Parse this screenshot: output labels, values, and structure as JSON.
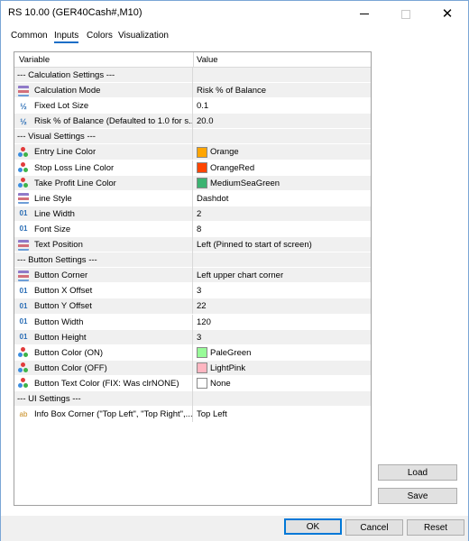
{
  "window": {
    "title": "RS 10.00 (GER40Cash#,M10)",
    "controls": {
      "minimize": "minimize-icon",
      "maximize": "maximize-icon",
      "close": "close-icon"
    }
  },
  "tabs": [
    {
      "label": "Common",
      "active": false
    },
    {
      "label": "Inputs",
      "active": true
    },
    {
      "label": "Colors",
      "active": false
    },
    {
      "label": "Visualization",
      "active": false
    }
  ],
  "grid": {
    "columns": {
      "variable": "Variable",
      "value": "Value"
    },
    "rows": [
      {
        "type": "section",
        "variable": "--- Calculation Settings ---",
        "value": ""
      },
      {
        "type": "param",
        "icon": "enum",
        "variable": "Calculation Mode",
        "value": "Risk % of Balance"
      },
      {
        "type": "param",
        "icon": "double",
        "variable": "Fixed Lot Size",
        "value": "0.1"
      },
      {
        "type": "param",
        "icon": "double",
        "variable": "Risk % of Balance (Defaulted to 1.0 for s...",
        "value": "20.0"
      },
      {
        "type": "section",
        "variable": "--- Visual Settings ---",
        "value": ""
      },
      {
        "type": "param",
        "icon": "color",
        "variable": "Entry Line Color",
        "value": "Orange",
        "swatch": "#ffa500"
      },
      {
        "type": "param",
        "icon": "color",
        "variable": "Stop Loss Line Color",
        "value": "OrangeRed",
        "swatch": "#ff4500"
      },
      {
        "type": "param",
        "icon": "color",
        "variable": "Take Profit Line Color",
        "value": "MediumSeaGreen",
        "swatch": "#3cb371"
      },
      {
        "type": "param",
        "icon": "enum",
        "variable": "Line Style",
        "value": "Dashdot"
      },
      {
        "type": "param",
        "icon": "int",
        "variable": "Line Width",
        "value": "2"
      },
      {
        "type": "param",
        "icon": "int",
        "variable": "Font Size",
        "value": "8"
      },
      {
        "type": "param",
        "icon": "enum",
        "variable": "Text Position",
        "value": "Left (Pinned to start of screen)"
      },
      {
        "type": "section",
        "variable": "--- Button Settings ---",
        "value": ""
      },
      {
        "type": "param",
        "icon": "enum",
        "variable": "Button Corner",
        "value": "Left upper chart corner"
      },
      {
        "type": "param",
        "icon": "int",
        "variable": "Button X Offset",
        "value": "3"
      },
      {
        "type": "param",
        "icon": "int",
        "variable": "Button Y Offset",
        "value": "22"
      },
      {
        "type": "param",
        "icon": "int",
        "variable": "Button Width",
        "value": "120"
      },
      {
        "type": "param",
        "icon": "int",
        "variable": "Button Height",
        "value": "3"
      },
      {
        "type": "param",
        "icon": "color",
        "variable": "Button Color (ON)",
        "value": "PaleGreen",
        "swatch": "#98fb98"
      },
      {
        "type": "param",
        "icon": "color",
        "variable": "Button Color (OFF)",
        "value": "LightPink",
        "swatch": "#ffb6c1"
      },
      {
        "type": "param",
        "icon": "color",
        "variable": "Button Text Color (FIX: Was clrNONE)",
        "value": "None",
        "swatch": "#ffffff"
      },
      {
        "type": "section",
        "variable": "--- UI Settings ---",
        "value": ""
      },
      {
        "type": "param",
        "icon": "string",
        "variable": "Info Box Corner (\"Top Left\", \"Top Right\",...",
        "value": "Top Left"
      }
    ]
  },
  "side_buttons": {
    "load": "Load",
    "save": "Save"
  },
  "footer_buttons": {
    "ok": "OK",
    "cancel": "Cancel",
    "reset": "Reset"
  }
}
